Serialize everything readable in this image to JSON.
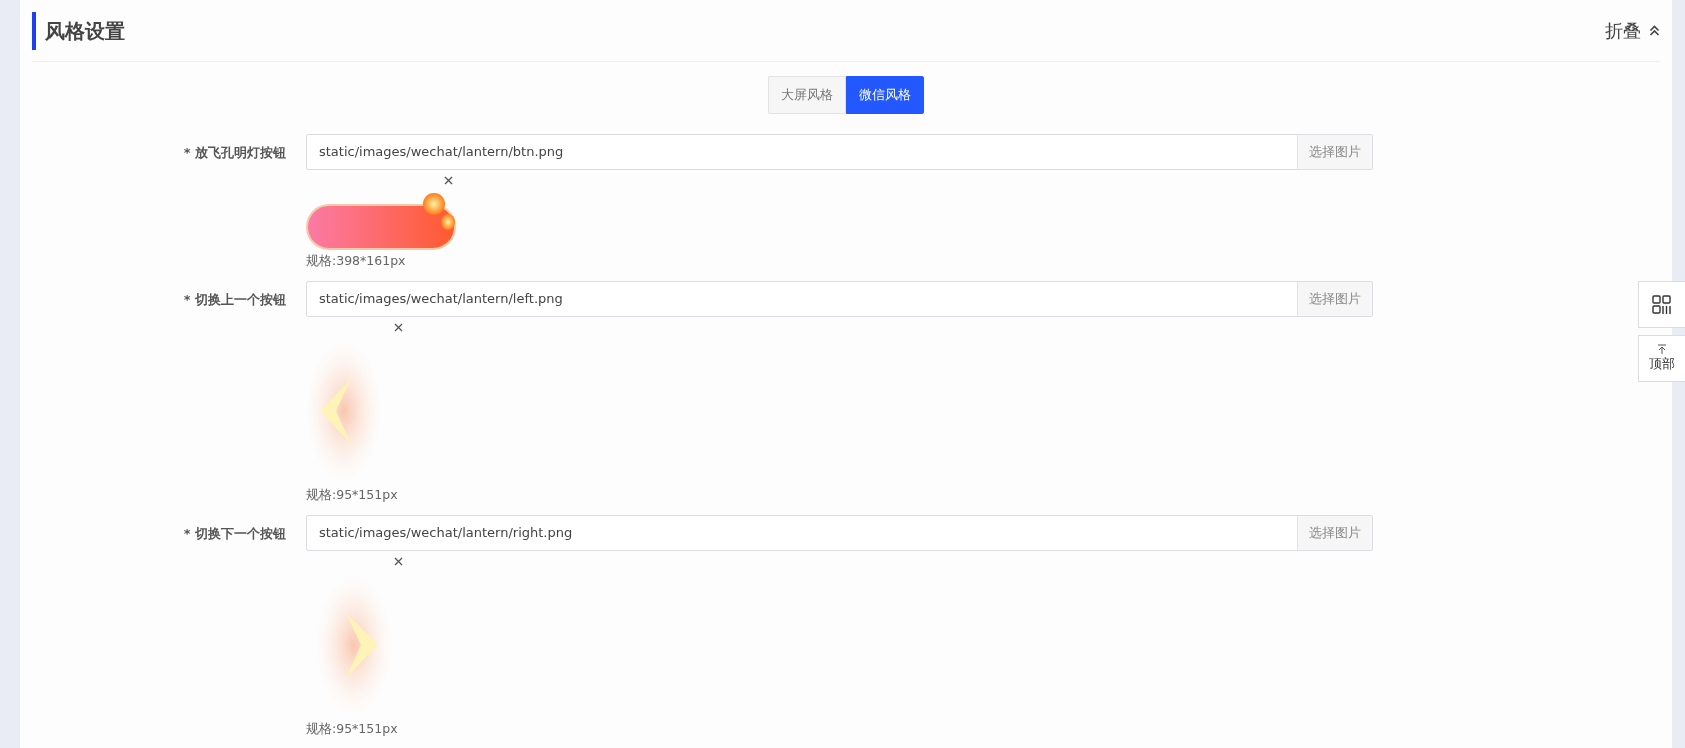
{
  "section": {
    "title": "风格设置",
    "collapse_label": "折叠"
  },
  "style_tabs": [
    {
      "label": "大屏风格",
      "selected": false
    },
    {
      "label": "微信风格",
      "selected": true
    }
  ],
  "fields": [
    {
      "label": "* 放飞孔明灯按钮",
      "value": "static/images/wechat/lantern/btn.png",
      "button": "选择图片",
      "kind": "pill",
      "spec": "规格:398*161px"
    },
    {
      "label": "* 切换上一个按钮",
      "value": "static/images/wechat/lantern/left.png",
      "button": "选择图片",
      "kind": "arrow-left",
      "spec": "规格:95*151px"
    },
    {
      "label": "* 切换下一个按钮",
      "value": "static/images/wechat/lantern/right.png",
      "button": "选择图片",
      "kind": "arrow-right",
      "spec": "规格:95*151px"
    }
  ],
  "side_buttons": [
    {
      "kind": "grid"
    },
    {
      "kind": "top",
      "label": "顶部"
    }
  ]
}
